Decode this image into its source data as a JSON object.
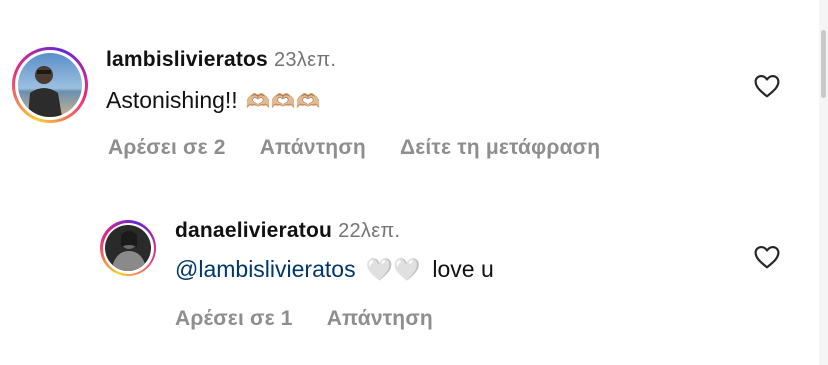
{
  "comments": [
    {
      "username": "lambislivieratos",
      "time": "23λεπ.",
      "text": "Astonishing!!",
      "emojis": "🫶🏼🫶🏼🫶🏼",
      "likes_label": "Αρέσει σε 2",
      "reply_label": "Απάντηση",
      "translate_label": "Δείτε τη μετάφραση",
      "icon": "heart-outline-icon"
    },
    {
      "username": "danaelivieratou",
      "time": "22λεπ.",
      "mention": "@lambislivieratos",
      "emojis": "🤍🤍",
      "text": "love u",
      "likes_label": "Αρέσει σε 1",
      "reply_label": "Απάντηση",
      "icon": "heart-outline-icon"
    }
  ],
  "colors": {
    "text": "#111111",
    "muted": "#8e8e8e",
    "time": "#737373",
    "mention": "#00376b"
  }
}
